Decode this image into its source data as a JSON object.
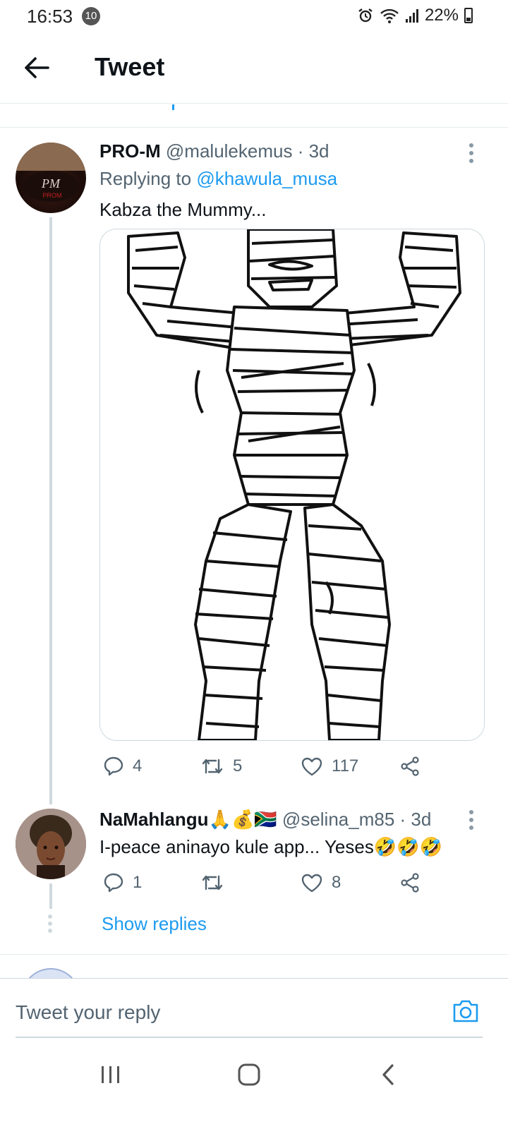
{
  "status_bar": {
    "time": "16:53",
    "notification_count": "10",
    "battery": "22%",
    "icons": [
      "alarm-icon",
      "wifi-icon",
      "signal-icon",
      "battery-icon"
    ]
  },
  "header": {
    "title": "Tweet",
    "back_icon": "arrow-left-icon"
  },
  "tweets": [
    {
      "name": "PRO-M",
      "handle": "@malulekemus",
      "time": "· 3d",
      "replying_prefix": "Replying to ",
      "replying_to": "@khawula_musa",
      "text": "Kabza the Mummy...",
      "media": "mummy-drawing",
      "replies": "4",
      "retweets": "5",
      "likes": "117"
    },
    {
      "name": "NaMahlangu🙏💰🇿🇦",
      "handle": "@selina_m85",
      "time": "· 3d",
      "text": "I-peace aninayo kule app... Yeses🤣🤣🤣",
      "replies": "1",
      "retweets": "",
      "likes": "8",
      "show_replies": "Show replies"
    }
  ],
  "reply_bar": {
    "placeholder": "Tweet your reply",
    "camera_icon": "camera-icon"
  },
  "colors": {
    "accent": "#1d9bf0",
    "text": "#0f1419",
    "secondary": "#536471",
    "border": "#cfd9de"
  }
}
